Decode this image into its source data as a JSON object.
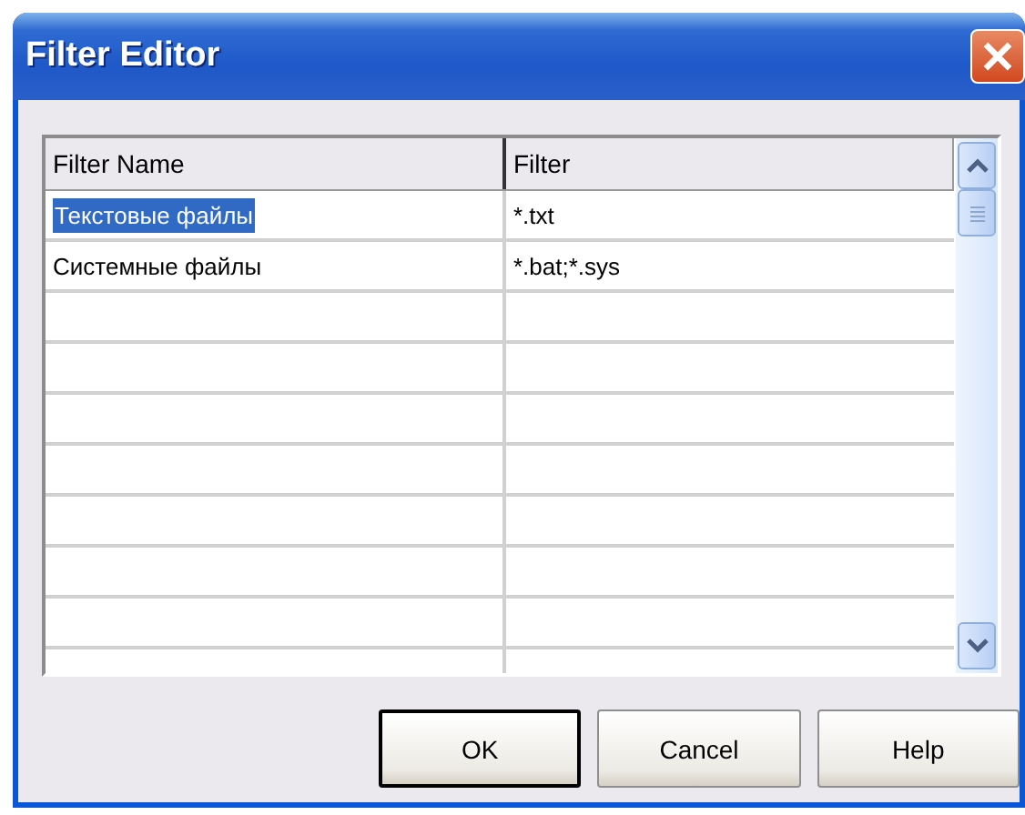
{
  "window": {
    "title": "Filter Editor"
  },
  "table": {
    "columns": [
      "Filter Name",
      "Filter"
    ],
    "rows": [
      {
        "name": "Текстовые файлы",
        "filter": "*.txt",
        "selected": true
      },
      {
        "name": "Системные файлы",
        "filter": "*.bat;*.sys",
        "selected": false
      }
    ]
  },
  "buttons": [
    {
      "label": "OK",
      "default": true
    },
    {
      "label": "Cancel",
      "default": false
    },
    {
      "label": "Help",
      "default": false
    }
  ]
}
